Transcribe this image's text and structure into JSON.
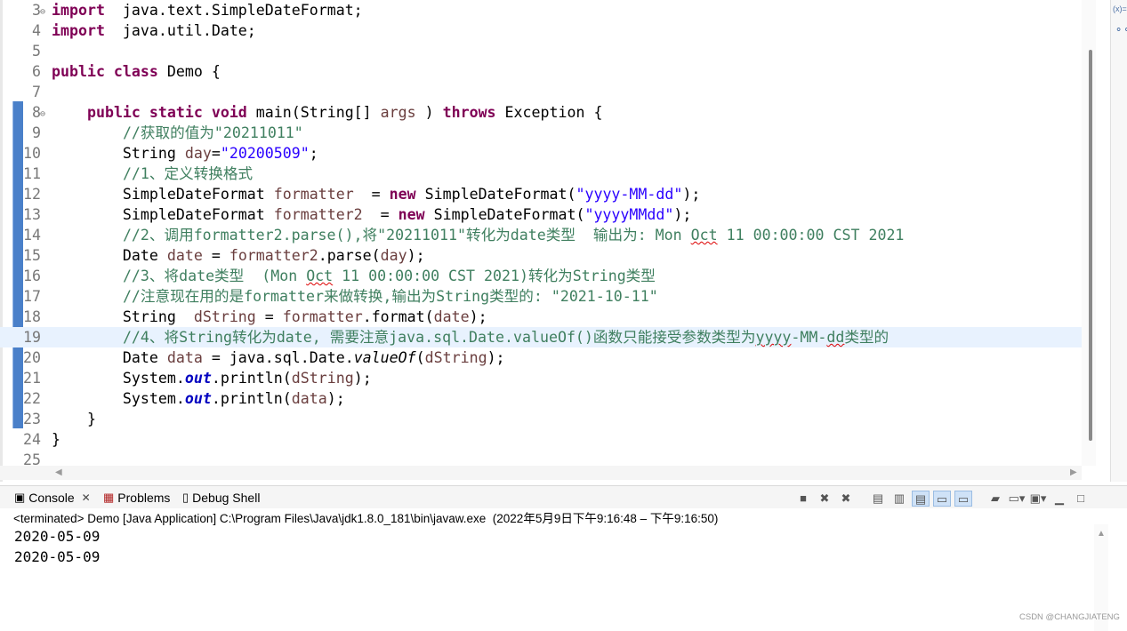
{
  "editor": {
    "lines": [
      {
        "n": "3",
        "fold": true,
        "parts": [
          [
            "kw",
            "import"
          ],
          [
            "",
            "  java.text.SimpleDateFormat;"
          ]
        ]
      },
      {
        "n": "4",
        "parts": [
          [
            "kw",
            "import"
          ],
          [
            "",
            "  java.util.Date;"
          ]
        ]
      },
      {
        "n": "5",
        "parts": []
      },
      {
        "n": "6",
        "parts": [
          [
            "kw",
            "public class"
          ],
          [
            "",
            " Demo {"
          ]
        ]
      },
      {
        "n": "7",
        "parts": []
      },
      {
        "n": "8",
        "fold": true,
        "parts": [
          [
            "",
            "    "
          ],
          [
            "kw",
            "public static void"
          ],
          [
            "",
            " main(String[] "
          ],
          [
            "var",
            "args"
          ],
          [
            "",
            " ) "
          ],
          [
            "kw",
            "throws"
          ],
          [
            "",
            " Exception {"
          ]
        ]
      },
      {
        "n": "9",
        "parts": [
          [
            "",
            "        "
          ],
          [
            "cm",
            "//获取的值为\"20211011\""
          ]
        ]
      },
      {
        "n": "10",
        "parts": [
          [
            "",
            "        String "
          ],
          [
            "var",
            "day"
          ],
          [
            "",
            "="
          ],
          [
            "str",
            "\"20200509\""
          ],
          [
            "",
            ";"
          ]
        ]
      },
      {
        "n": "11",
        "parts": [
          [
            "",
            "        "
          ],
          [
            "cm",
            "//1、定义转换格式"
          ]
        ]
      },
      {
        "n": "12",
        "parts": [
          [
            "",
            "        SimpleDateFormat "
          ],
          [
            "var",
            "formatter"
          ],
          [
            "",
            "  = "
          ],
          [
            "kw",
            "new"
          ],
          [
            "",
            " SimpleDateFormat("
          ],
          [
            "str",
            "\"yyyy-MM-dd\""
          ],
          [
            "",
            ");"
          ]
        ]
      },
      {
        "n": "13",
        "parts": [
          [
            "",
            "        SimpleDateFormat "
          ],
          [
            "var",
            "formatter2"
          ],
          [
            "",
            "  = "
          ],
          [
            "kw",
            "new"
          ],
          [
            "",
            " SimpleDateFormat("
          ],
          [
            "str",
            "\"yyyyMMdd\""
          ],
          [
            "",
            ");"
          ]
        ]
      },
      {
        "n": "14",
        "parts": [
          [
            "",
            "        "
          ],
          [
            "cm",
            "//2、调用formatter2.parse(),将\"20211011\"转化为date类型  输出为: Mon "
          ],
          [
            "cm sq",
            "Oct"
          ],
          [
            "cm",
            " 11 00:00:00 CST 2021"
          ]
        ]
      },
      {
        "n": "15",
        "parts": [
          [
            "",
            "        Date "
          ],
          [
            "var",
            "date"
          ],
          [
            "",
            " = "
          ],
          [
            "var",
            "formatter2"
          ],
          [
            "",
            ".parse("
          ],
          [
            "var",
            "day"
          ],
          [
            "",
            ");"
          ]
        ]
      },
      {
        "n": "16",
        "parts": [
          [
            "",
            "        "
          ],
          [
            "cm",
            "//3、将date类型  (Mon "
          ],
          [
            "cm sq",
            "Oct"
          ],
          [
            "cm",
            " 11 00:00:00 CST 2021)转化为String类型"
          ]
        ]
      },
      {
        "n": "17",
        "parts": [
          [
            "",
            "        "
          ],
          [
            "cm",
            "//注意现在用的是formatter来做转换,输出为String类型的: \"2021-10-11\""
          ]
        ]
      },
      {
        "n": "18",
        "parts": [
          [
            "",
            "        String  "
          ],
          [
            "var",
            "dString"
          ],
          [
            "",
            " = "
          ],
          [
            "var",
            "formatter"
          ],
          [
            "",
            ".format("
          ],
          [
            "var",
            "date"
          ],
          [
            "",
            ");"
          ]
        ]
      },
      {
        "n": "19",
        "hl": true,
        "parts": [
          [
            "",
            "        "
          ],
          [
            "cm",
            "//4、将String转化为date, 需要注意java.sql.Date.valueOf()函数只能接受参数类型为"
          ],
          [
            "cm sq",
            "yyyy"
          ],
          [
            "cm",
            "-MM-"
          ],
          [
            "cm sq",
            "dd"
          ],
          [
            "cm",
            "类型的"
          ]
        ]
      },
      {
        "n": "20",
        "parts": [
          [
            "",
            "        Date "
          ],
          [
            "var",
            "data"
          ],
          [
            "",
            " = java.sql.Date."
          ],
          [
            "it",
            "valueOf"
          ],
          [
            "",
            "("
          ],
          [
            "var",
            "dString"
          ],
          [
            "",
            ");"
          ]
        ]
      },
      {
        "n": "21",
        "parts": [
          [
            "",
            "        System."
          ],
          [
            "fld",
            "out"
          ],
          [
            "",
            ".println("
          ],
          [
            "var",
            "dString"
          ],
          [
            "",
            ");"
          ]
        ]
      },
      {
        "n": "22",
        "parts": [
          [
            "",
            "        System."
          ],
          [
            "fld",
            "out"
          ],
          [
            "",
            ".println("
          ],
          [
            "var",
            "data"
          ],
          [
            "",
            ");"
          ]
        ]
      },
      {
        "n": "23",
        "parts": [
          [
            "",
            "    }"
          ]
        ]
      },
      {
        "n": "24",
        "parts": [
          [
            "",
            "}"
          ]
        ]
      },
      {
        "n": "25",
        "parts": []
      }
    ]
  },
  "right_panel": {
    "xvar_label": "(x)=",
    "icon": "breakpoints-icon"
  },
  "console": {
    "tabs": [
      {
        "label": "Console",
        "icon": "console-icon",
        "closable": true
      },
      {
        "label": "Problems",
        "icon": "problems-icon"
      },
      {
        "label": "Debug Shell",
        "icon": "debug-shell-icon"
      }
    ],
    "status": "<terminated> Demo [Java Application] C:\\Program Files\\Java\\jdk1.8.0_181\\bin\\javaw.exe  (2022年5月9日下午9:16:48 – 下午9:16:50)",
    "output": [
      "2020-05-09",
      "2020-05-09"
    ],
    "watermark": "CSDN @CHANGJIATENG"
  },
  "colors": {
    "keyword": "#7f0055",
    "comment": "#3f7f5f",
    "string": "#2a00ff",
    "variable": "#6a3e3e",
    "field": "#0000c0",
    "highlight": "#e8f2fe"
  }
}
